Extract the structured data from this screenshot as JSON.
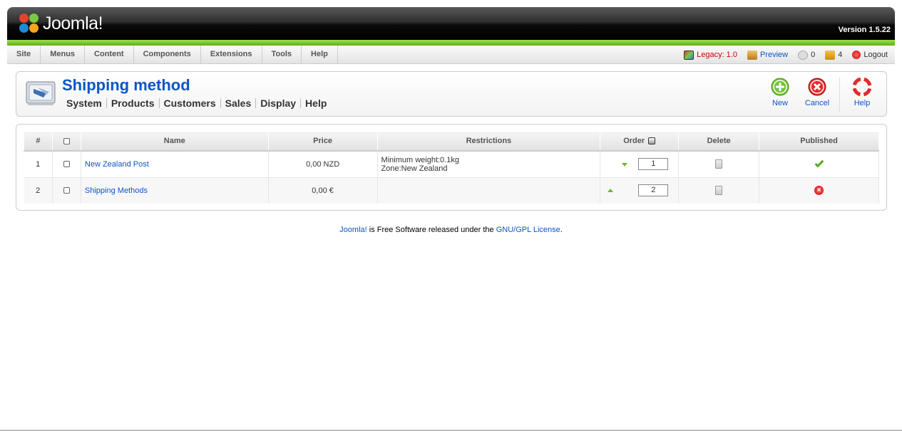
{
  "header": {
    "logo_text": "Joomla!",
    "version": "Version 1.5.22"
  },
  "menu": {
    "items": [
      {
        "label": "Site"
      },
      {
        "label": "Menus"
      },
      {
        "label": "Content"
      },
      {
        "label": "Components"
      },
      {
        "label": "Extensions"
      },
      {
        "label": "Tools"
      },
      {
        "label": "Help"
      }
    ]
  },
  "status": {
    "legacy": "Legacy: 1.0",
    "preview": "Preview",
    "messages": "0",
    "users": "4",
    "logout": "Logout"
  },
  "toolbar": {
    "title": "Shipping method",
    "submenu": [
      {
        "label": "System"
      },
      {
        "label": "Products"
      },
      {
        "label": "Customers"
      },
      {
        "label": "Sales"
      },
      {
        "label": "Display"
      },
      {
        "label": "Help"
      }
    ],
    "buttons": {
      "new": "New",
      "cancel": "Cancel",
      "help": "Help"
    }
  },
  "table": {
    "headers": {
      "num": "#",
      "name": "Name",
      "price": "Price",
      "restrictions": "Restrictions",
      "order": "Order",
      "delete": "Delete",
      "published": "Published"
    },
    "rows": [
      {
        "num": "1",
        "name": "New Zealand Post",
        "price": "0,00 NZD",
        "restriction_1": "Minimum weight:0.1kg",
        "restriction_2": "Zone:New Zealand",
        "order": "1",
        "published": true
      },
      {
        "num": "2",
        "name": "Shipping Methods",
        "price": "0,00 €",
        "restriction_1": "",
        "restriction_2": "",
        "order": "2",
        "published": false
      }
    ]
  },
  "footer": {
    "link1": "Joomla!",
    "text": " is Free Software released under the ",
    "link2": "GNU/GPL License",
    "end": "."
  },
  "colors": {
    "accent_blue": "#0b55c4",
    "green_bar": "#7ac943",
    "legacy_red": "#cc0000"
  }
}
